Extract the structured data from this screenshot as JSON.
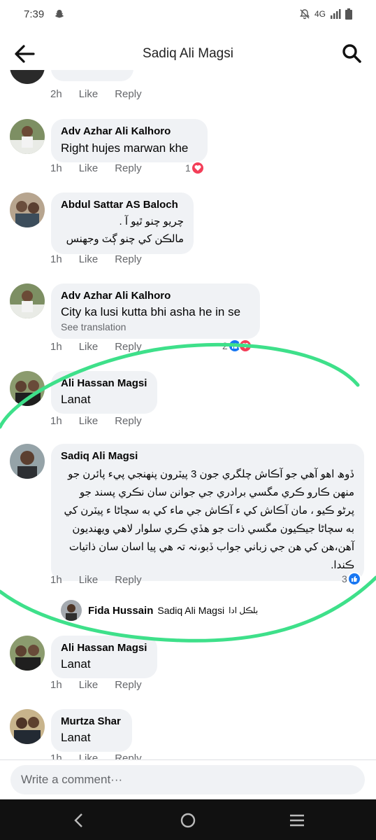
{
  "status": {
    "time": "7:39",
    "network": "4G"
  },
  "header": {
    "title": "Sadiq Ali Magsi"
  },
  "top_comment_meta": {
    "time": "2h",
    "like": "Like",
    "reply": "Reply"
  },
  "comments": [
    {
      "author": "Adv Azhar Ali Kalhoro",
      "text": "Right hujes marwan khe",
      "time": "1h",
      "like": "Like",
      "reply": "Reply",
      "reaction_count": "1"
    },
    {
      "author": "Abdul Sattar AS Baloch",
      "text": "چريو چنو ٿيو آ .\nمالڪن کي چنو ڳٽ وجهنس",
      "time": "1h",
      "like": "Like",
      "reply": "Reply"
    },
    {
      "author": "Adv Azhar Ali Kalhoro",
      "text": "City ka lusi kutta bhi asha he in se",
      "see_translation": "See translation",
      "time": "1h",
      "like": "Like",
      "reply": "Reply",
      "reaction_count": "2"
    },
    {
      "author": "Ali Hassan Magsi",
      "text": "Lanat",
      "time": "1h",
      "like": "Like",
      "reply": "Reply"
    },
    {
      "author": "Sadiq Ali Magsi",
      "text": "ڏوھ اھو آھي جو آڪاش چلگري جون 3 پيٽرون پنھنجي پيء پائرن جو منھن ڪارو ڪري مگسي برادري جي جوانن سان نڪري پسند جو پرڻو ڪيو ، مان آڪاش کي ء آڪاش جي ماء کي به سچاڻا ء پيٽرن کي به سچاڻا جيڪيون مگسي ذات جو ھڏي ڪري سلوار لاھي ويھنديون آھن،ھن کي ھن جي زباني جواب ڏبو،نہ تہ ھي پيا اسان سان ذاتيات ڪندا.",
      "time": "1h",
      "like": "Like",
      "reply": "Reply",
      "reaction_count": "3"
    },
    {
      "author": "Ali Hassan Magsi",
      "text": "Lanat",
      "time": "1h",
      "like": "Like",
      "reply": "Reply"
    },
    {
      "author": "Murtza Shar",
      "text": "Lanat",
      "time": "1h",
      "like": "Like",
      "reply": "Reply"
    }
  ],
  "reply_preview": {
    "name": "Fida Hussain",
    "tag": "Sadiq Ali Magsi",
    "text": "بلڪل ادا"
  },
  "composer": {
    "placeholder": "Write a comment···"
  },
  "colors": {
    "accent": "#1877f2",
    "heart": "#f33e58",
    "annotation": "#3ee08a",
    "bubble": "#f0f2f5"
  }
}
